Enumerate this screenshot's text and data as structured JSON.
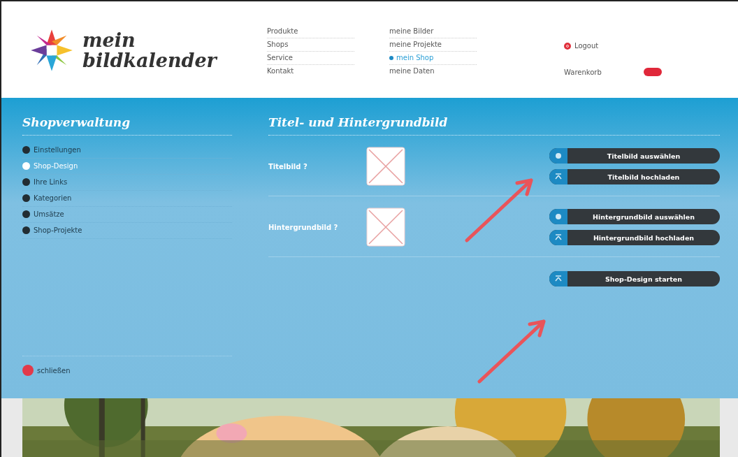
{
  "logo": {
    "line_1": "mein",
    "line_2": "bildkalender"
  },
  "nav_left": [
    {
      "label": "Produkte"
    },
    {
      "label": "Shops"
    },
    {
      "label": "Service"
    },
    {
      "label": "Kontakt"
    }
  ],
  "nav_right": [
    {
      "label": "meine Bilder",
      "selected": false
    },
    {
      "label": "meine Projekte",
      "selected": false
    },
    {
      "label": "mein Shop",
      "selected": true
    },
    {
      "label": "meine Daten",
      "selected": false
    }
  ],
  "account": {
    "logout": "Logout",
    "cart": "Warenkorb"
  },
  "sidebar": {
    "title": "Shopverwaltung",
    "items": [
      {
        "label": "Einstellungen",
        "selected": false
      },
      {
        "label": "Shop-Design",
        "selected": true
      },
      {
        "label": "Ihre Links",
        "selected": false
      },
      {
        "label": "Kategorien",
        "selected": false
      },
      {
        "label": "Umsätze",
        "selected": false
      },
      {
        "label": "Shop-Projekte",
        "selected": false
      }
    ],
    "close": "schließen"
  },
  "main": {
    "title": "Titel- und Hintergrundbild",
    "sections": [
      {
        "label": "Titelbild ?",
        "buttons": [
          {
            "label": "Titelbild auswählen",
            "kind": "select"
          },
          {
            "label": "Titelbild hochladen",
            "kind": "upload"
          }
        ]
      },
      {
        "label": "Hintergrundbild ?",
        "buttons": [
          {
            "label": "Hintergrundbild auswählen",
            "kind": "select"
          },
          {
            "label": "Hintergrundbild hochladen",
            "kind": "upload"
          }
        ]
      }
    ],
    "start_button": {
      "label": "Shop-Design starten",
      "kind": "upload"
    }
  }
}
